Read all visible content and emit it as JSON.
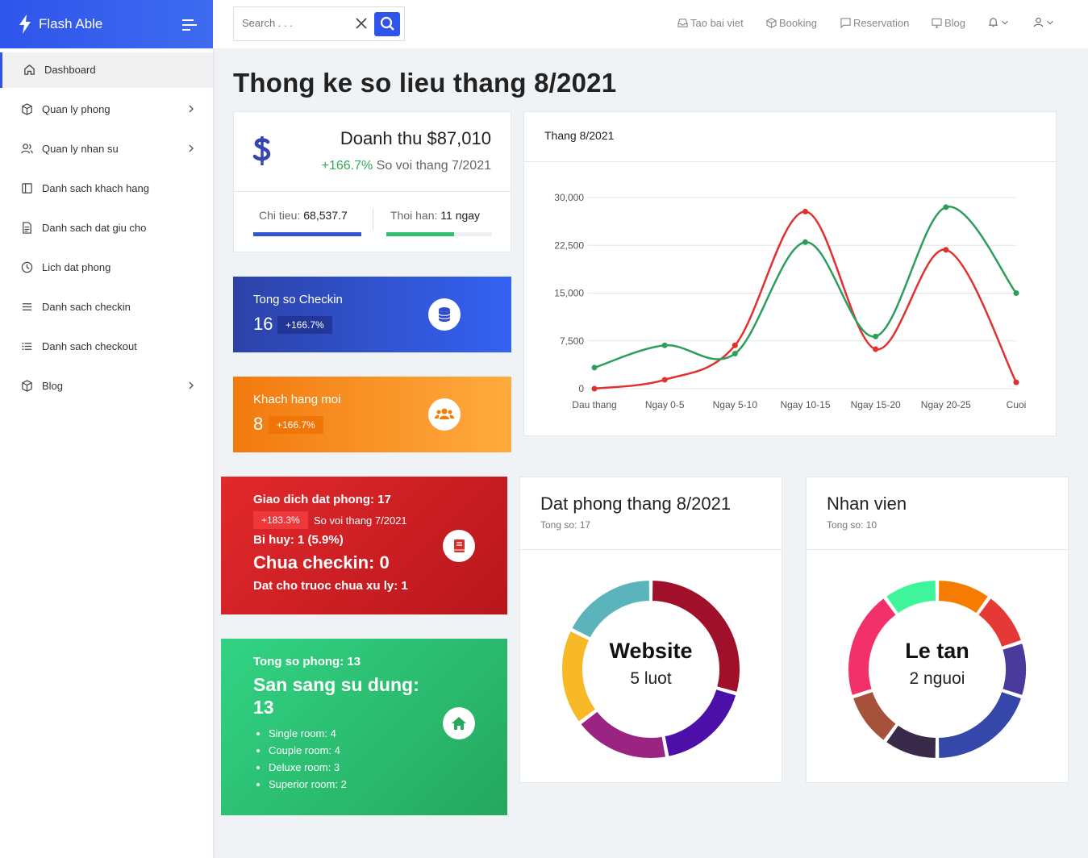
{
  "brand": {
    "name": "Flash Able"
  },
  "sidebar": {
    "items": [
      {
        "label": "Dashboard"
      },
      {
        "label": "Quan ly phong"
      },
      {
        "label": "Quan ly nhan su"
      },
      {
        "label": "Danh sach khach hang"
      },
      {
        "label": "Danh sach dat giu cho"
      },
      {
        "label": "Lich dat phong"
      },
      {
        "label": "Danh sach checkin"
      },
      {
        "label": "Danh sach checkout"
      },
      {
        "label": "Blog"
      }
    ]
  },
  "header": {
    "search_placeholder": "Search . . .",
    "links": [
      "Tao bai viet",
      "Booking",
      "Reservation",
      "Blog"
    ]
  },
  "page_title": "Thong ke so lieu thang 8/2021",
  "revenue": {
    "title": "Doanh thu $87,010",
    "change": "+166.7%",
    "compare": "So voi thang 7/2021",
    "spend_label": "Chi tieu:",
    "spend_value": "68,537.7",
    "spend_progress": 1.0,
    "term_label": "Thoi han:",
    "term_value": "11 ngay",
    "term_progress": 0.64,
    "colors": {
      "spend": "#3453d1",
      "term": "#2fbf71"
    }
  },
  "checkin": {
    "title": "Tong so Checkin",
    "value": "16",
    "badge": "+166.7%",
    "icon": "database-icon"
  },
  "new_customers": {
    "title": "Khach hang moi",
    "value": "8",
    "badge": "+166.7%",
    "icon": "users-icon"
  },
  "bookings": {
    "line1": "Giao dich dat phong: 17",
    "badge": "+183.3%",
    "compare": "So voi thang 7/2021",
    "cancelled": "Bi huy: 1 (5.9%)",
    "not_checked": "Chua checkin: 0",
    "pending": "Dat cho truoc chua xu ly: 1",
    "icon": "book-icon"
  },
  "rooms": {
    "total": "Tong so phong: 13",
    "available": "San sang su dung:",
    "available_count": "13",
    "list": [
      "Single room: 4",
      "Couple room: 4",
      "Deluxe room: 3",
      "Superior room: 2"
    ],
    "icon": "home-icon"
  },
  "line_panel": {
    "title": "Thang 8/2021"
  },
  "chart_data": [
    {
      "type": "line",
      "title": "Thang 8/2021",
      "categories": [
        "Dau thang",
        "Ngay 0-5",
        "Ngay 5-10",
        "Ngay 10-15",
        "Ngay 15-20",
        "Ngay 20-25",
        "Cuoi"
      ],
      "series": [
        {
          "color": "#e03131",
          "values": [
            0,
            1400,
            6800,
            27800,
            6200,
            21800,
            1000
          ]
        },
        {
          "color": "#2b9e5b",
          "values": [
            3300,
            6800,
            5500,
            23000,
            8200,
            28500,
            15000
          ]
        }
      ],
      "yticks": [
        "0",
        "7,500",
        "15,000",
        "22,500",
        "30,000"
      ],
      "ylim": [
        0,
        30000
      ],
      "grid": true
    },
    {
      "type": "pie",
      "title": "Dat phong thang 8/2021",
      "subtitle": "Tong so: 17",
      "center_label": "Website",
      "center_value": "5 luot",
      "values": [
        5,
        3,
        3,
        3,
        3
      ],
      "colors": [
        "#a0102a",
        "#4c0fa8",
        "#9b2382",
        "#f7b928",
        "#5bb4bb"
      ]
    },
    {
      "type": "pie",
      "title": "Nhan vien",
      "subtitle": "Tong so: 10",
      "center_label": "Le tan",
      "center_value": "2 nguoi",
      "values": [
        1,
        1,
        1,
        2,
        1,
        1,
        2,
        1
      ],
      "colors": [
        "#f57c00",
        "#e53935",
        "#4a3a9c",
        "#3547a8",
        "#3a2a4a",
        "#a6513a",
        "#f2316b",
        "#3ef59b"
      ]
    }
  ]
}
